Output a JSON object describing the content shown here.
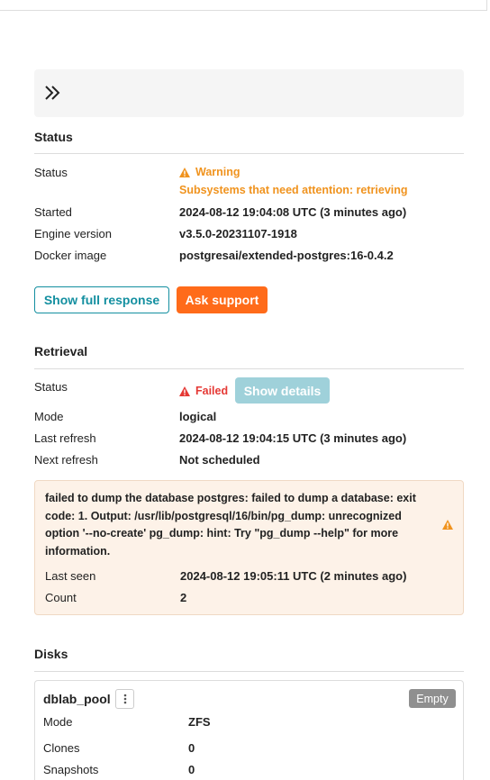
{
  "status_section": {
    "title": "Status",
    "rows": {
      "status_label": "Status",
      "status_warning": "Warning",
      "status_warning_detail": "Subsystems that need attention: retrieving",
      "started_label": "Started",
      "started_value": "2024-08-12 19:04:08 UTC (3 minutes ago)",
      "engine_label": "Engine version",
      "engine_value": "v3.5.0-20231107-1918",
      "docker_label": "Docker image",
      "docker_value": "postgresai/extended-postgres:16-0.4.2"
    },
    "buttons": {
      "show_full_response": "Show full response",
      "ask_support": "Ask support"
    }
  },
  "retrieval_section": {
    "title": "Retrieval",
    "status_label": "Status",
    "status_value": "Failed",
    "show_details": "Show details",
    "mode_label": "Mode",
    "mode_value": "logical",
    "last_refresh_label": "Last refresh",
    "last_refresh_value": "2024-08-12 19:04:15 UTC (3 minutes ago)",
    "next_refresh_label": "Next refresh",
    "next_refresh_value": "Not scheduled",
    "error": {
      "message": "failed to dump the database postgres: failed to dump a database: exit code: 1. Output: /usr/lib/postgresql/16/bin/pg_dump: unrecognized option '--no-create' pg_dump: hint: Try \"pg_dump --help\" for more information.",
      "last_seen_label": "Last seen",
      "last_seen_value": "2024-08-12 19:05:11 UTC (2 minutes ago)",
      "count_label": "Count",
      "count_value": "2"
    }
  },
  "disks_section": {
    "title": "Disks",
    "pool": {
      "name": "dblab_pool",
      "badge": "Empty",
      "mode_label": "Mode",
      "mode_value": "ZFS",
      "clones_label": "Clones",
      "clones_value": "0",
      "snapshots_label": "Snapshots",
      "snapshots_value": "0"
    }
  },
  "colors": {
    "accent_teal": "#138fa0",
    "accent_orange": "#ff6b1a",
    "warning": "#f0931e",
    "error": "#e53935"
  },
  "icons": {
    "collapse": "double-chevron-right-icon",
    "warning": "warning-triangle-icon",
    "kebab": "kebab-menu-icon"
  }
}
